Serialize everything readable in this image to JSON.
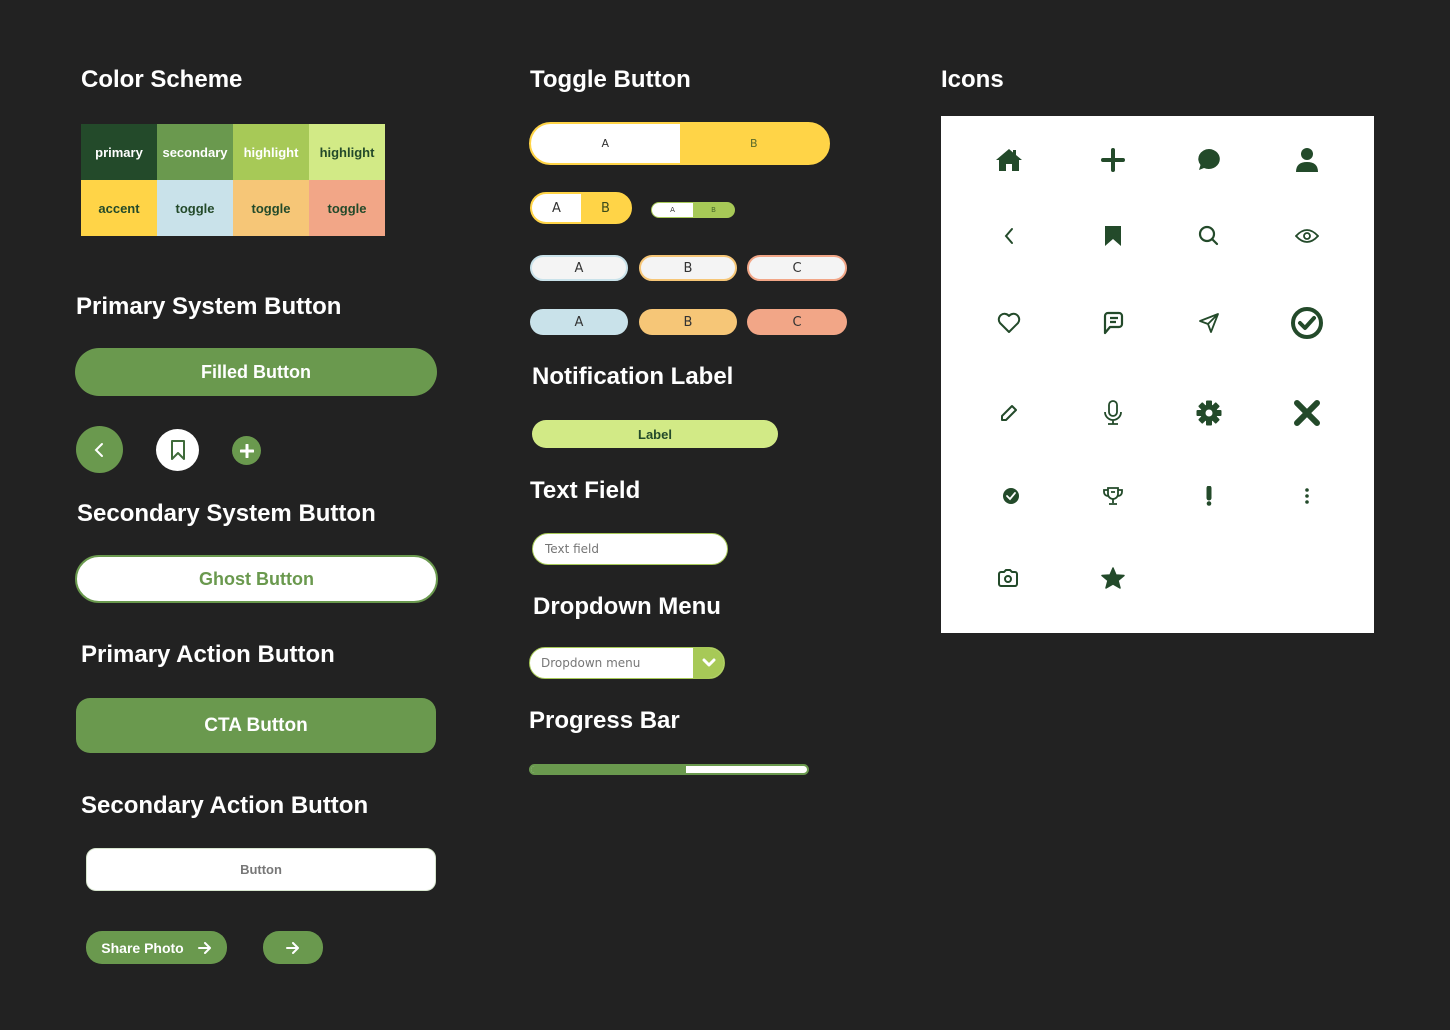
{
  "colors": {
    "primary": "#234A2A",
    "secondary": "#6A994E",
    "highlight": "#A7C957",
    "highlight_light": "#D2EA86",
    "accent": "#FFD447",
    "toggle_blue": "#C9E2EA",
    "toggle_orange": "#F6C677",
    "toggle_salmon": "#F2A687",
    "background": "#222222"
  },
  "sections": {
    "color_scheme": "Color Scheme",
    "primary_system_button": "Primary System Button",
    "secondary_system_button": "Secondary System Button",
    "primary_action_button": "Primary Action Button",
    "secondary_action_button": "Secondary Action Button",
    "toggle_button": "Toggle Button",
    "notification_label": "Notification Label",
    "text_field": "Text Field",
    "dropdown_menu": "Dropdown Menu",
    "progress_bar": "Progress Bar",
    "icons": "Icons"
  },
  "swatches": [
    {
      "label": "primary",
      "color": "#234A2A",
      "text": "#FFFFFF"
    },
    {
      "label": "secondary",
      "color": "#6A994E",
      "text": "#FFFFFF"
    },
    {
      "label": "highlight",
      "color": "#A7C957",
      "text": "#FFFFFF"
    },
    {
      "label": "highlight",
      "color": "#D2EA86",
      "text": "#234A2A"
    },
    {
      "label": "accent",
      "color": "#FFD447",
      "text": "#234A2A"
    },
    {
      "label": "toggle",
      "color": "#C9E2EA",
      "text": "#234A2A"
    },
    {
      "label": "toggle",
      "color": "#F6C677",
      "text": "#234A2A"
    },
    {
      "label": "toggle",
      "color": "#F2A687",
      "text": "#234A2A"
    }
  ],
  "buttons": {
    "filled": "Filled Button",
    "ghost": "Ghost Button",
    "cta": "CTA Button",
    "secondary_action": "Button",
    "share_photo": "Share Photo",
    "arrow": "→"
  },
  "toggles": {
    "large": {
      "a": "A",
      "b": "B"
    },
    "medium": {
      "a": "A",
      "b": "B"
    },
    "small": {
      "a": "A",
      "b": "B"
    },
    "outline_row": [
      "A",
      "B",
      "C"
    ],
    "filled_row": [
      "A",
      "B",
      "C"
    ]
  },
  "notification": {
    "label": "Label"
  },
  "text_field": {
    "placeholder": "Text field"
  },
  "dropdown": {
    "selected": "Dropdown menu"
  },
  "progress": {
    "value": 0.56
  },
  "icons": [
    "home-icon",
    "plus-icon",
    "chat-bubble-icon",
    "user-icon",
    "chevron-left-icon",
    "bookmark-icon",
    "search-icon",
    "eye-icon",
    "heart-icon",
    "comment-icon",
    "send-icon",
    "check-circle-icon",
    "pencil-icon",
    "microphone-icon",
    "gear-icon",
    "close-icon",
    "check-badge-icon",
    "trophy-icon",
    "exclamation-icon",
    "more-vertical-icon",
    "camera-icon",
    "star-icon"
  ]
}
